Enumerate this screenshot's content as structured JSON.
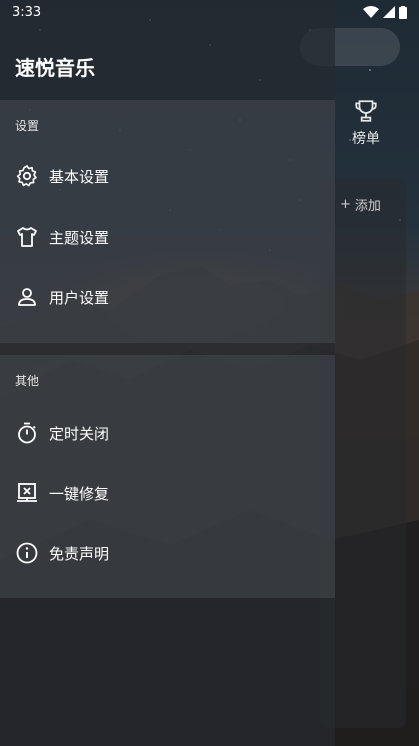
{
  "status": {
    "time": "3:33"
  },
  "app": {
    "title": "速悦音乐"
  },
  "behind": {
    "chart_label": "榜单",
    "add_label": "添加"
  },
  "drawer": {
    "sections": [
      {
        "title": "设置",
        "items": [
          {
            "label": "基本设置",
            "icon": "gear-icon"
          },
          {
            "label": "主题设置",
            "icon": "shirt-icon"
          },
          {
            "label": "用户设置",
            "icon": "user-icon"
          }
        ]
      },
      {
        "title": "其他",
        "items": [
          {
            "label": "定时关闭",
            "icon": "timer-icon"
          },
          {
            "label": "一键修复",
            "icon": "repair-icon"
          },
          {
            "label": "免责声明",
            "icon": "info-icon"
          }
        ]
      }
    ]
  }
}
